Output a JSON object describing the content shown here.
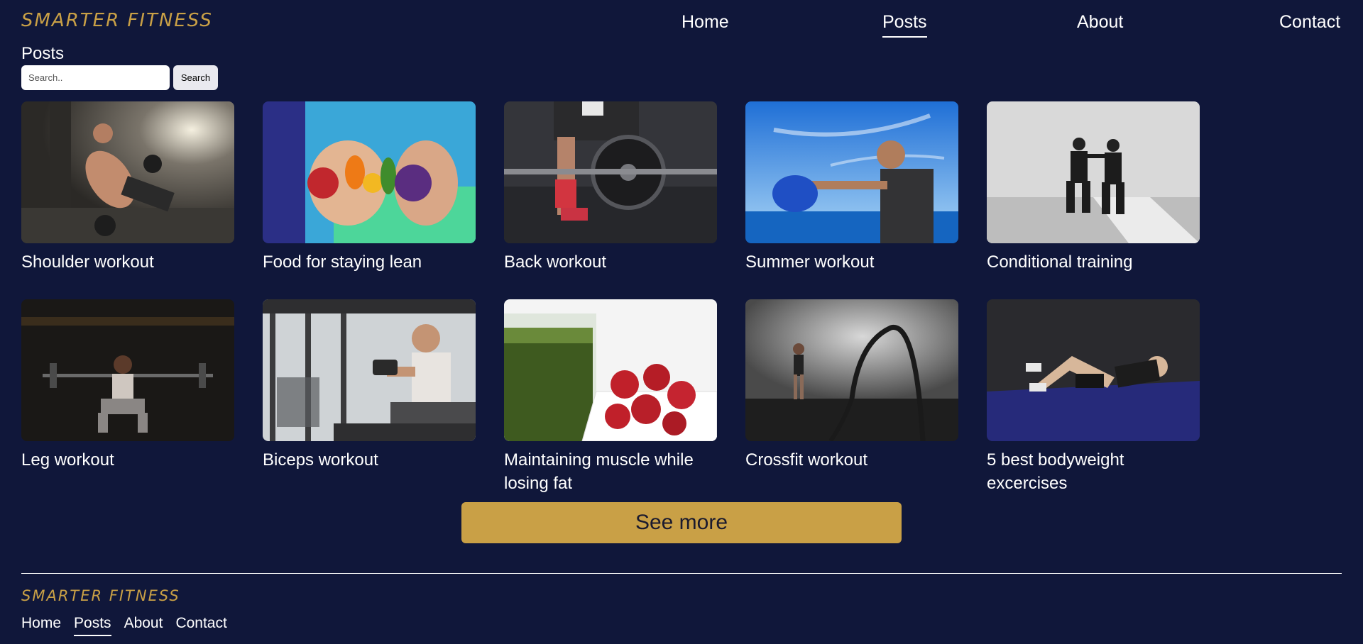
{
  "brand": {
    "name": "SMARTER FITNESS",
    "color": "#c9a046"
  },
  "nav": {
    "items": [
      {
        "label": "Home",
        "active": false
      },
      {
        "label": "Posts",
        "active": true
      },
      {
        "label": "About",
        "active": false
      },
      {
        "label": "Contact",
        "active": false
      }
    ]
  },
  "page": {
    "heading": "Posts"
  },
  "search": {
    "placeholder": "Search..",
    "value": "",
    "button_label": "Search"
  },
  "posts": [
    {
      "title": "Shoulder workout"
    },
    {
      "title": "Food for staying lean"
    },
    {
      "title": "Back workout"
    },
    {
      "title": "Summer workout"
    },
    {
      "title": "Conditional training"
    },
    {
      "title": "Leg workout"
    },
    {
      "title": "Biceps workout"
    },
    {
      "title": "Maintaining muscle while losing fat"
    },
    {
      "title": "Crossfit workout"
    },
    {
      "title": "5 best bodyweight excercises"
    }
  ],
  "see_more": {
    "label": "See more"
  },
  "footer": {
    "brand": "SMARTER FITNESS",
    "nav": [
      {
        "label": "Home",
        "active": false
      },
      {
        "label": "Posts",
        "active": true
      },
      {
        "label": "About",
        "active": false
      },
      {
        "label": "Contact",
        "active": false
      }
    ]
  },
  "colors": {
    "background": "#10173a",
    "accent": "#c9a046",
    "text": "#ffffff"
  }
}
